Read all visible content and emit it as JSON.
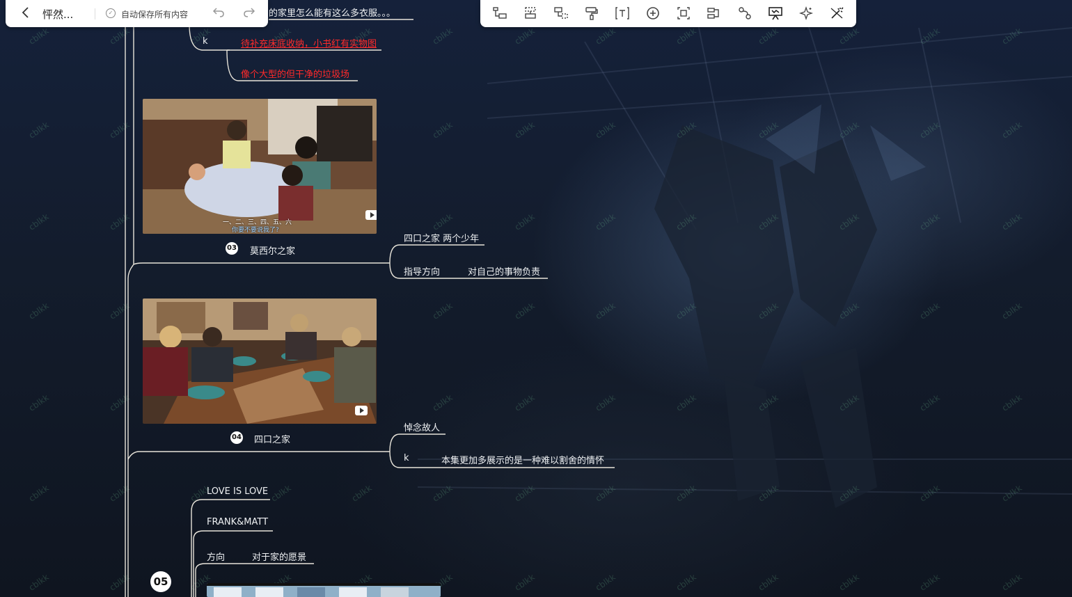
{
  "toolbar_left": {
    "back_icon": "chevron-left-icon",
    "doc_title": "怦然...",
    "save_status": "自动保存所有内容",
    "undo_icon": "undo-icon",
    "redo_icon": "redo-icon"
  },
  "toolbar_right": {
    "tools": [
      {
        "name": "insert-subtopic-icon"
      },
      {
        "name": "insert-sibling-icon"
      },
      {
        "name": "insert-parent-icon"
      },
      {
        "name": "format-painter-icon"
      },
      {
        "name": "text-icon"
      },
      {
        "name": "add-icon"
      },
      {
        "name": "summary-icon"
      },
      {
        "name": "relationship-icon"
      },
      {
        "name": "link-icon"
      },
      {
        "name": "presentation-icon"
      },
      {
        "name": "ai-sparkle-icon"
      },
      {
        "name": "magic-wand-icon"
      }
    ]
  },
  "watermark": "cblkk",
  "mindmap": {
    "top_partial": "的家里怎么能有这么多衣服。。。",
    "k_label_1": "k",
    "red_note_1": "待补充床底收纳，小书红有实物图",
    "red_note_2": "像个大型的但干净的垃圾场",
    "section_03": {
      "badge": "03",
      "title": "莫西尔之家",
      "image_subtitle_1": "一、二、三、四、五、六",
      "image_subtitle_2": "你要不要说我了?",
      "branch_1": "四口之家 两个少年",
      "branch_2": "指导方向",
      "branch_2_child": "对自己的事物负责"
    },
    "section_04": {
      "badge": "04",
      "title": "四口之家",
      "branch_1": "悼念故人",
      "branch_2": "k",
      "branch_2_child": "本集更加多展示的是一种难以割舍的情怀"
    },
    "section_05": {
      "badge": "05",
      "branch_1": "LOVE IS LOVE",
      "branch_2": "FRANK&MATT",
      "branch_3": "方向",
      "branch_3_child": "对于家的愿景"
    }
  }
}
